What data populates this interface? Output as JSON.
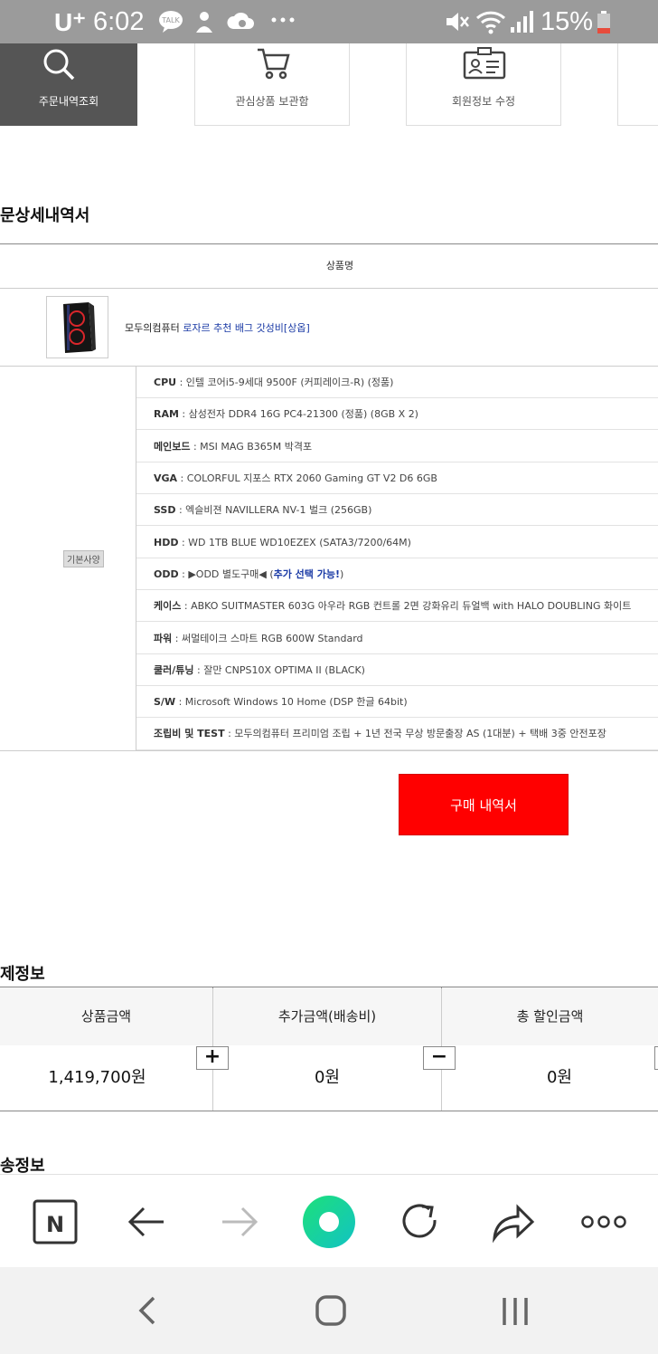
{
  "status_bar": {
    "carrier": "U⁺",
    "time": "6:02",
    "battery": "15%"
  },
  "tabs": [
    {
      "label": "주문내역조회"
    },
    {
      "label": "관심상품 보관함"
    },
    {
      "label": "회원정보 수정"
    }
  ],
  "order_detail": {
    "title": "문상세내역서",
    "column_header": "상품명",
    "product": {
      "brand": "모두의컴퓨터",
      "name": "로자르 추천 배그 갓성비[상옵]"
    },
    "spec_badge": "기본사양",
    "specs": [
      {
        "label": "CPU",
        "value": " : 인텔 코어i5-9세대 9500F (커피레이크-R) (정품)",
        "extra": ""
      },
      {
        "label": "RAM",
        "value": " : 삼성전자 DDR4 16G PC4-21300 (정품) (8GB X 2)",
        "extra": ""
      },
      {
        "label": "메인보드",
        "value": " : MSI MAG B365M 박격포",
        "extra": ""
      },
      {
        "label": "VGA",
        "value": " : COLORFUL 지포스 RTX 2060 Gaming GT V2 D6 6GB",
        "extra": ""
      },
      {
        "label": "SSD",
        "value": " : 엑슬비젼 NAVILLERA NV-1 벌크 (256GB)",
        "extra": ""
      },
      {
        "label": "HDD",
        "value": " : WD 1TB BLUE WD10EZEX (SATA3/7200/64M)",
        "extra": ""
      },
      {
        "label": "ODD",
        "value": " :  ▶ODD 별도구매◀ (",
        "extra": "추가 선택 가능!",
        "tail": ")"
      },
      {
        "label": "케이스",
        "value": " : ABKO SUITMASTER 603G 아우라 RGB 컨트롤 2면 강화유리 듀얼백 with HALO DOUBLING 화이트",
        "extra": ""
      },
      {
        "label": "파워",
        "value": " : 써멀테이크 스마트 RGB 600W Standard",
        "extra": ""
      },
      {
        "label": "쿨러/튜닝",
        "value": " : 잘만 CNPS10X OPTIMA II (BLACK)",
        "extra": ""
      },
      {
        "label": "S/W",
        "value": " : Microsoft Windows 10 Home (DSP 한글 64bit)",
        "extra": ""
      },
      {
        "label": "조립비 및 TEST",
        "value": " : 모두의컴퓨터 프리미엄 조립 + 1년 전국 무상 방문출장 AS (1대분) + 택배 3중 안전포장",
        "extra": ""
      }
    ],
    "purchase_button": "구매 내역서"
  },
  "payment": {
    "title": "제정보",
    "columns": [
      {
        "header": "상품금액",
        "value": "1,419,700원"
      },
      {
        "header": "추가금액(배송비)",
        "value": "0원"
      },
      {
        "header": "총 할인금액",
        "value": "0원"
      }
    ],
    "plus": "+",
    "minus": "−"
  },
  "shipping": {
    "title": "송정보"
  },
  "browser": {
    "n_label": "N"
  },
  "colors": {
    "buy_button": "#ff0000",
    "status_bar": "#9b9b9b",
    "active_tab": "#555555",
    "link_blue": "#1a3aa5",
    "green_accent": "#19d36a"
  }
}
